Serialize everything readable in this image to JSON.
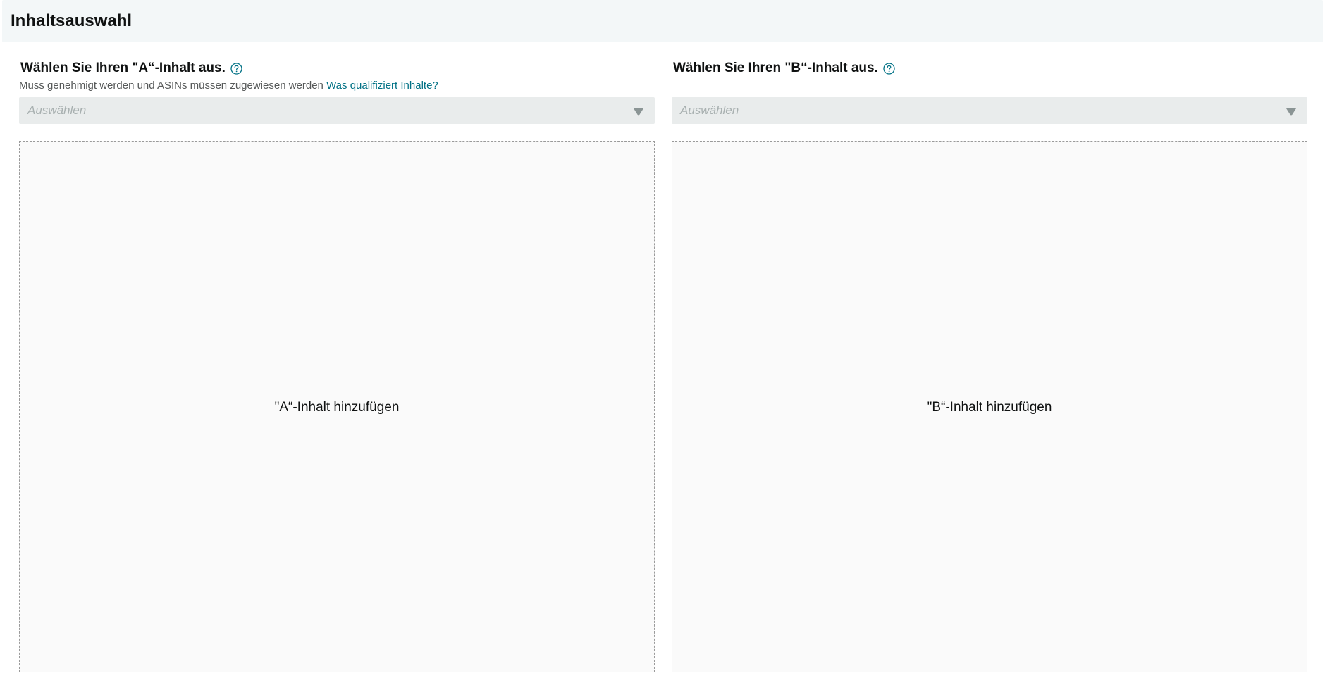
{
  "header": {
    "title": "Inhaltsauswahl"
  },
  "content_a": {
    "label": "Wählen Sie Ihren \"A“-Inhalt aus.",
    "help_icon": "question-circle-icon",
    "subtitle": "Muss genehmigt werden und ASINs müssen zugewiesen werden",
    "subtitle_link": "Was qualifiziert Inhalte?",
    "select_placeholder": "Auswählen",
    "drop_zone_label": "\"A“-Inhalt hinzufügen"
  },
  "content_b": {
    "label": "Wählen Sie Ihren \"B“-Inhalt aus.",
    "help_icon": "question-circle-icon",
    "select_placeholder": "Auswählen",
    "drop_zone_label": "\"B“-Inhalt hinzufügen"
  },
  "colors": {
    "link": "#007185",
    "header_bg": "#f3f7f8",
    "select_bg": "#e9ecec",
    "drop_zone_bg": "#fafafa"
  }
}
